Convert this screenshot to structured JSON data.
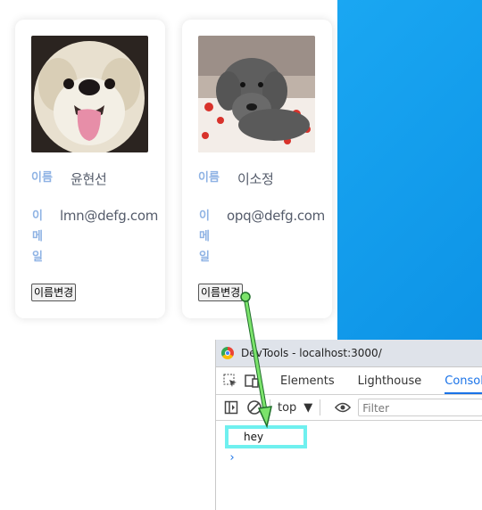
{
  "cards": [
    {
      "name_label": "이름",
      "name_value": "윤현선",
      "email_label_chars": [
        "이",
        "메",
        "일"
      ],
      "email_value": "lmn@defg.com",
      "button_label": "이름변경"
    },
    {
      "name_label": "이름",
      "name_value": "이소정",
      "email_label_chars": [
        "이",
        "메",
        "일"
      ],
      "email_value": "opq@defg.com",
      "button_label": "이름변경"
    }
  ],
  "devtools": {
    "window_title": "DevTools - localhost:3000/",
    "tabs": [
      "Elements",
      "Lighthouse",
      "Console"
    ],
    "active_tab": "Console",
    "context": "top",
    "filter_placeholder": "Filter",
    "log_output": "hey",
    "prompt_symbol": "›"
  },
  "colors": {
    "label": "#8fb3e4",
    "value": "#555c6b",
    "highlight": "#6ff0ef",
    "arrow": "#7be36b",
    "accent": "#1a73e8",
    "blue_bg": "#0d93e6"
  },
  "icons": [
    "chrome-icon",
    "inspect-icon",
    "device-toolbar-icon",
    "sidebar-icon",
    "clear-console-icon",
    "dropdown-arrow-icon",
    "eye-icon"
  ]
}
